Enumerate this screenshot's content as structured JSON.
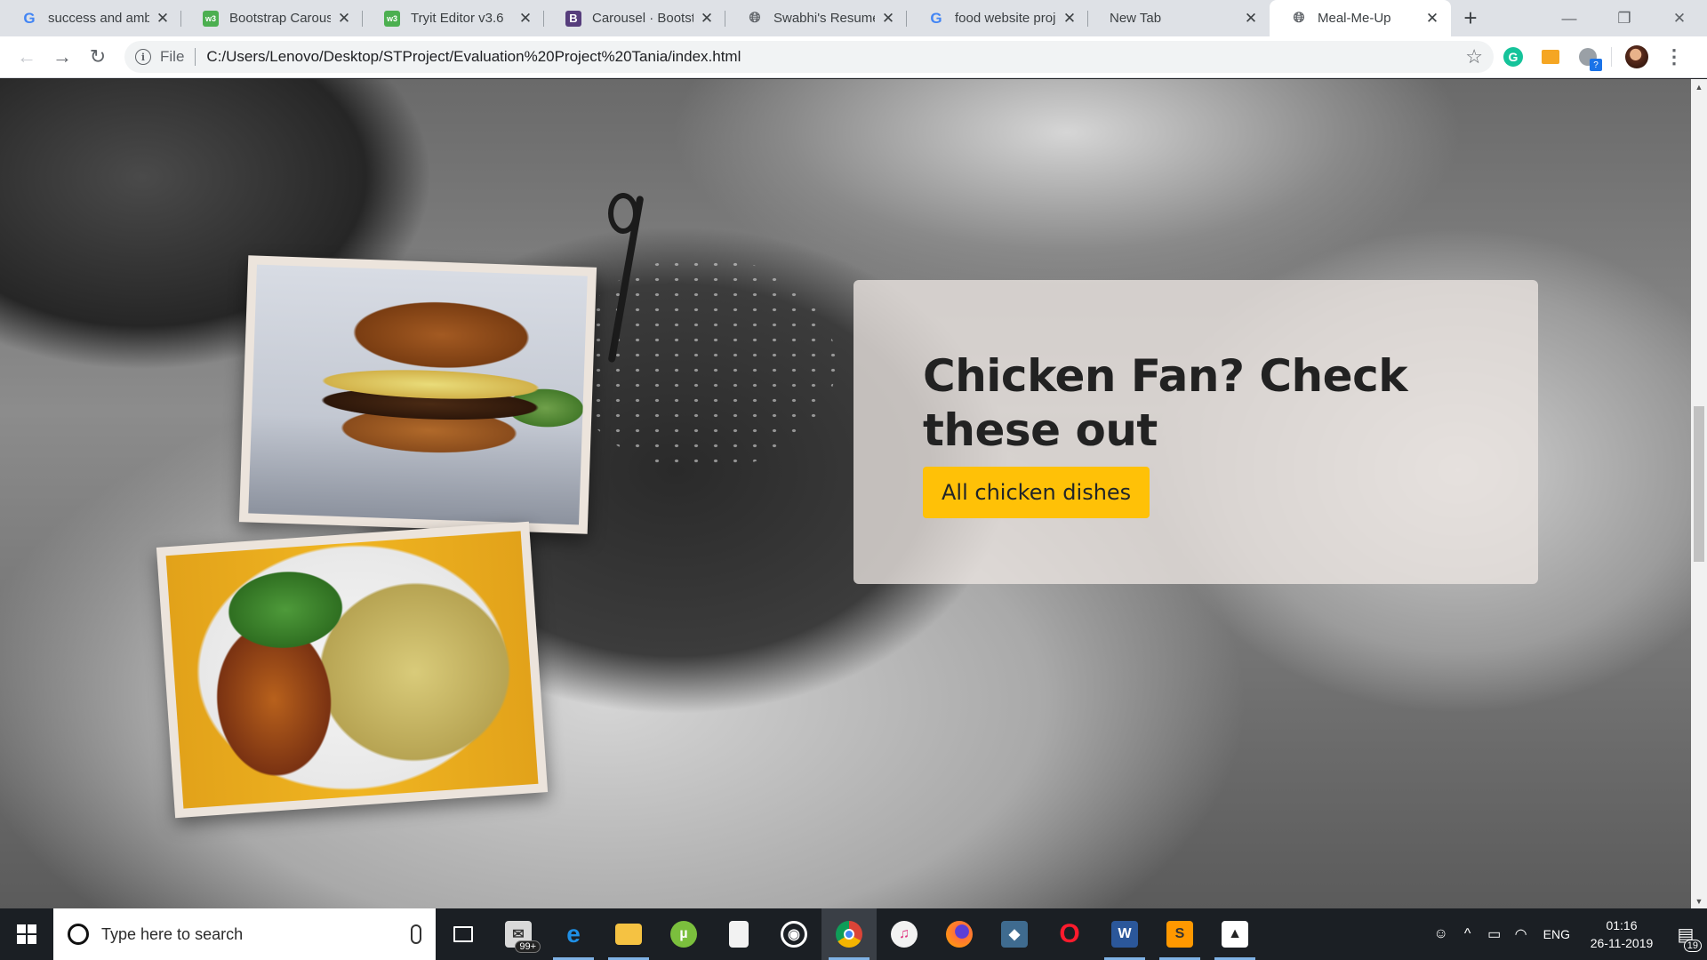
{
  "browser": {
    "tabs": [
      {
        "title": "success and ambit",
        "favicon": "google-icon"
      },
      {
        "title": "Bootstrap Carouse",
        "favicon": "w3schools-icon"
      },
      {
        "title": "Tryit Editor v3.6",
        "favicon": "w3schools-icon"
      },
      {
        "title": "Carousel · Bootstra",
        "favicon": "bootstrap-icon"
      },
      {
        "title": "Swabhi's Resume",
        "favicon": "globe-icon"
      },
      {
        "title": "food website proje",
        "favicon": "google-icon"
      },
      {
        "title": "New Tab",
        "favicon": "none"
      },
      {
        "title": "Meal-Me-Up",
        "favicon": "globe-icon",
        "active": true
      }
    ],
    "address": {
      "scheme": "File",
      "url": "C:/Users/Lenovo/Desktop/STProject/Evaluation%20Project%20Tania/index.html"
    }
  },
  "page": {
    "promo": {
      "title": "Chicken Fan? Check these out",
      "button_label": "All chicken dishes",
      "button_color": "#ffc107"
    }
  },
  "taskbar": {
    "search_placeholder": "Type here to search",
    "mail_badge": "99+",
    "language": "ENG",
    "time": "01:16",
    "date": "26-11-2019",
    "notification_count": "19"
  }
}
